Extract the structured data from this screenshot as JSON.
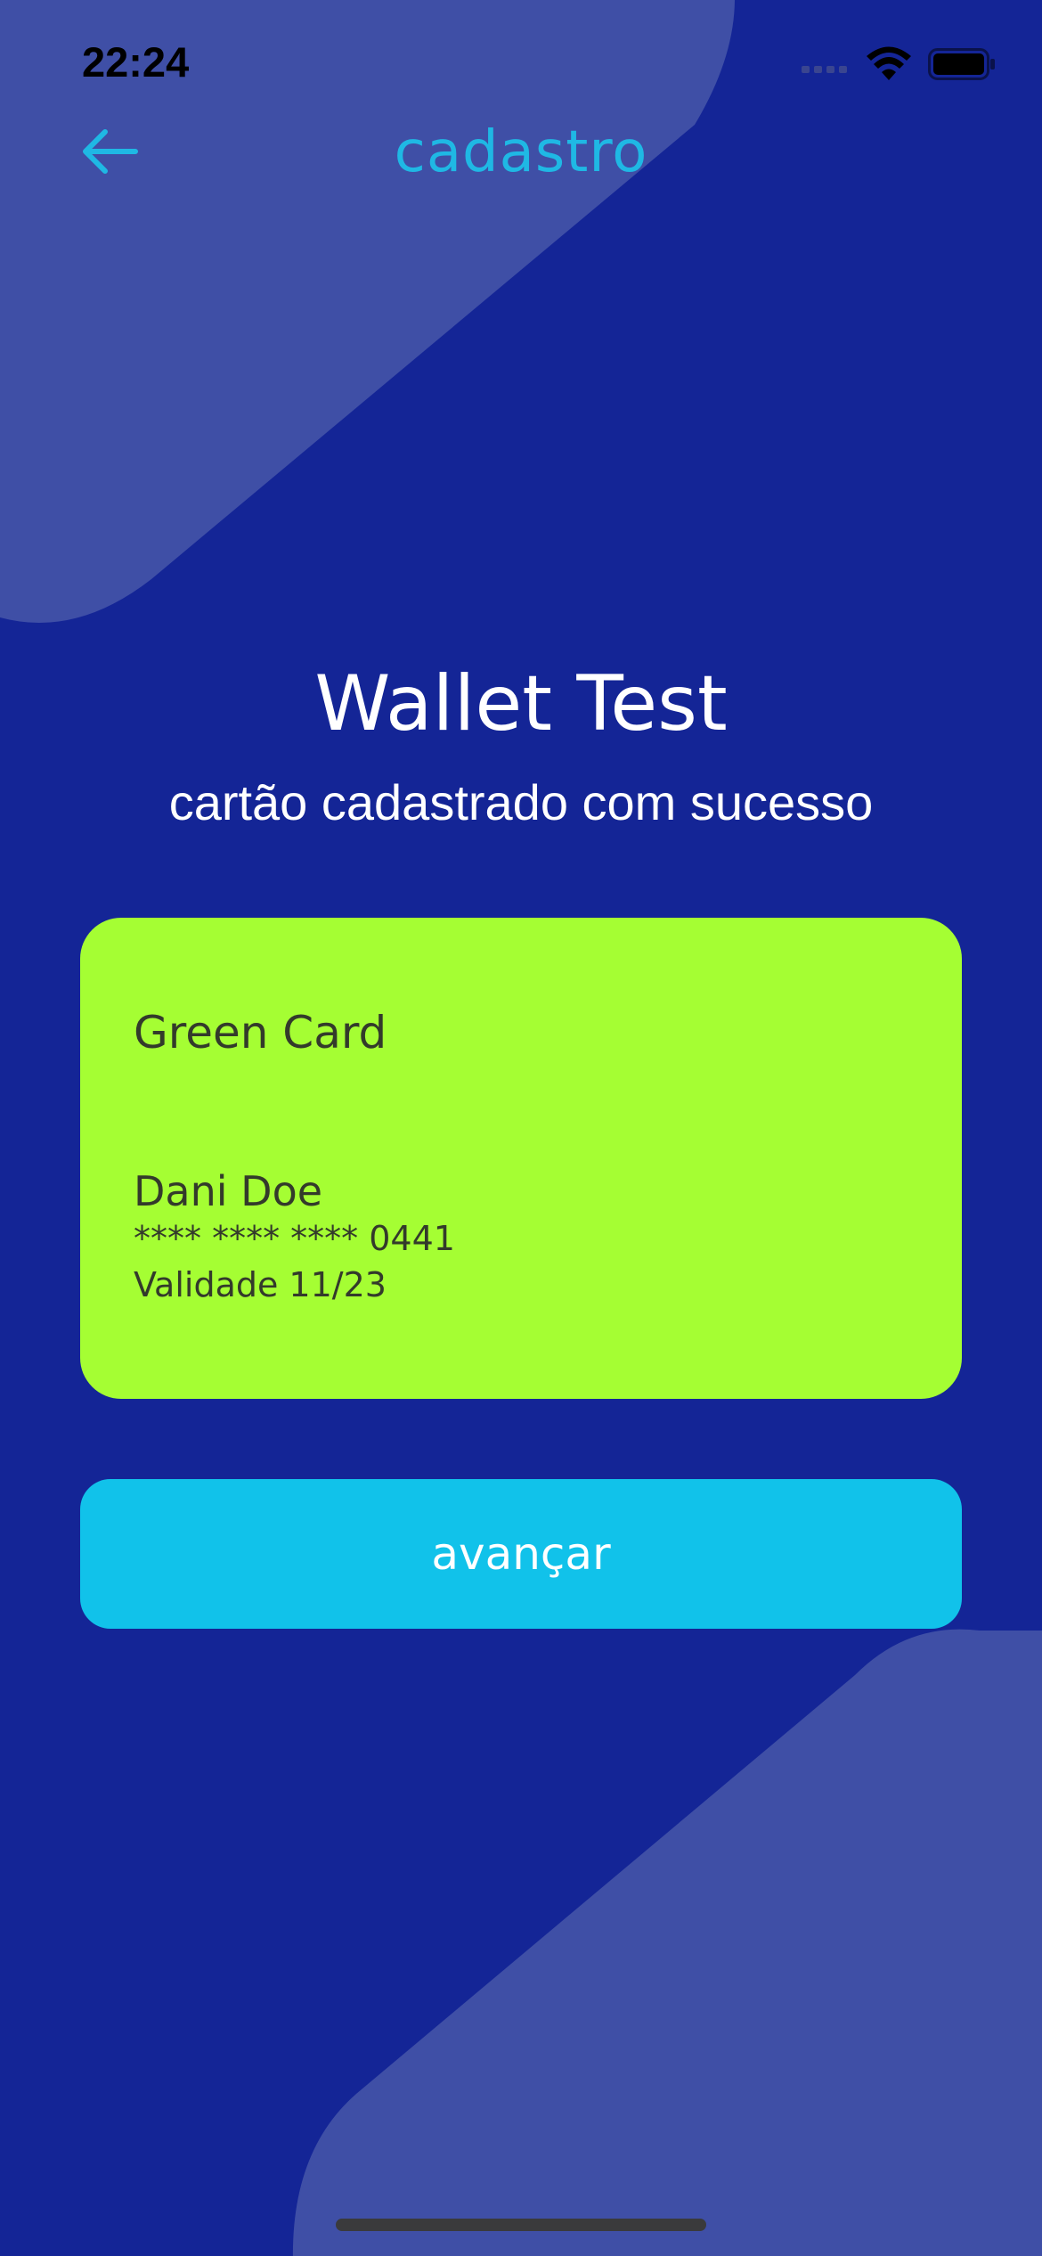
{
  "status_bar": {
    "time": "22:24",
    "signal_icon": "cellular-signal-icon",
    "wifi_icon": "wifi-icon",
    "battery_icon": "battery-icon"
  },
  "nav": {
    "back_icon": "arrow-left-icon",
    "title": "cadastro"
  },
  "header": {
    "title": "Wallet Test",
    "subtitle": "cartão cadastrado com sucesso"
  },
  "card": {
    "name": "Green Card",
    "holder": "Dani Doe",
    "number": "**** **** **** 0441",
    "expiry": "Validade 11/23",
    "color": "#A5FE33"
  },
  "actions": {
    "next_label": "avançar"
  },
  "colors": {
    "background": "#142596",
    "decor_shape": "#3F4FA6",
    "accent": "#1FB8E4",
    "button": "#11C2EA",
    "card_text": "#333A2B"
  }
}
